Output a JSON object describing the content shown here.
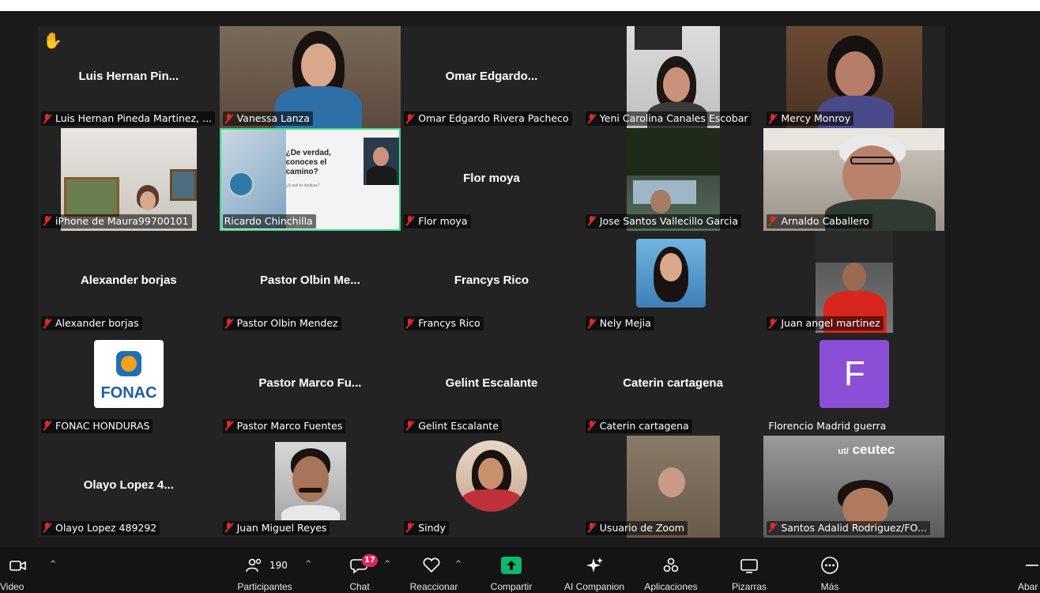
{
  "gallery": {
    "tiles": [
      {
        "display_name": "Luis Hernan Pin...",
        "label": "Luis Hernan Pineda Martinez, ...",
        "hand_icon": "✋"
      },
      {
        "label": "Vanessa Lanza"
      },
      {
        "display_name": "Omar  Edgardo...",
        "label": "Omar Edgardo Rivera Pacheco"
      },
      {
        "label": "Yeni Carolina Canales Escobar"
      },
      {
        "label": "Mercy Monroy"
      },
      {
        "label": "iPhone de Maura99700101"
      },
      {
        "label": "Ricardo Chinchilla",
        "slide": {
          "line1": "¿De verdad,",
          "line2": "conoces el",
          "line3": "camino?",
          "small": "¿A qué te dedicas?"
        }
      },
      {
        "display_name": "Flor moya",
        "label": "Flor moya"
      },
      {
        "label": "Jose Santos Vallecillo Garcia"
      },
      {
        "label": "Arnaldo Caballero"
      },
      {
        "display_name": "Alexander borjas",
        "label": "Alexander borjas"
      },
      {
        "display_name": "Pastor  Olbin  Me...",
        "label": "Pastor Olbin Mendez"
      },
      {
        "display_name": "Francys Rico",
        "label": "Francys Rico"
      },
      {
        "label": "Nely Mejia"
      },
      {
        "label": "Juan angel martinez"
      },
      {
        "label": "FONAC HONDURAS",
        "logo_text": "FONAC"
      },
      {
        "display_name": "Pastor  Marco  Fu...",
        "label": "Pastor Marco Fuentes"
      },
      {
        "display_name": "Gelint Escalante",
        "label": "Gelint Escalante"
      },
      {
        "display_name": "Caterin cartagena",
        "label": "Caterin cartagena"
      },
      {
        "label": "Florencio Madrid guerra",
        "avatar_letter": "F"
      },
      {
        "display_name": "Olayo Lopez   4...",
        "label": "Olayo Lopez   489292"
      },
      {
        "label": "Juan Miguel Reyes"
      },
      {
        "label": "Sindy"
      },
      {
        "label": "Usuario de Zoom"
      },
      {
        "label": "Santos Adalid Rodriguez/FO...",
        "wall_text": "ceutec",
        "wall_logo": "ut/"
      }
    ]
  },
  "toolbar": {
    "video": "Video",
    "participants_label": "Participantes",
    "participants_count": "190",
    "chat_label": "Chat",
    "chat_badge": "17",
    "react_label": "Reaccionar",
    "share_label": "Compartir",
    "ai_label": "AI Companion",
    "apps_label": "Aplicaciones",
    "whiteboard_label": "Pizarras",
    "more_label": "Más",
    "right_label": "Abar"
  },
  "colors": {
    "background": "#1a1a1a",
    "tile": "#232323",
    "active_border": "#3ddc84",
    "muted_mic": "#e02a2a",
    "share_green": "#0fb86f",
    "chat_badge": "#e0245e",
    "avatar_purple": "#8a4fd6"
  }
}
